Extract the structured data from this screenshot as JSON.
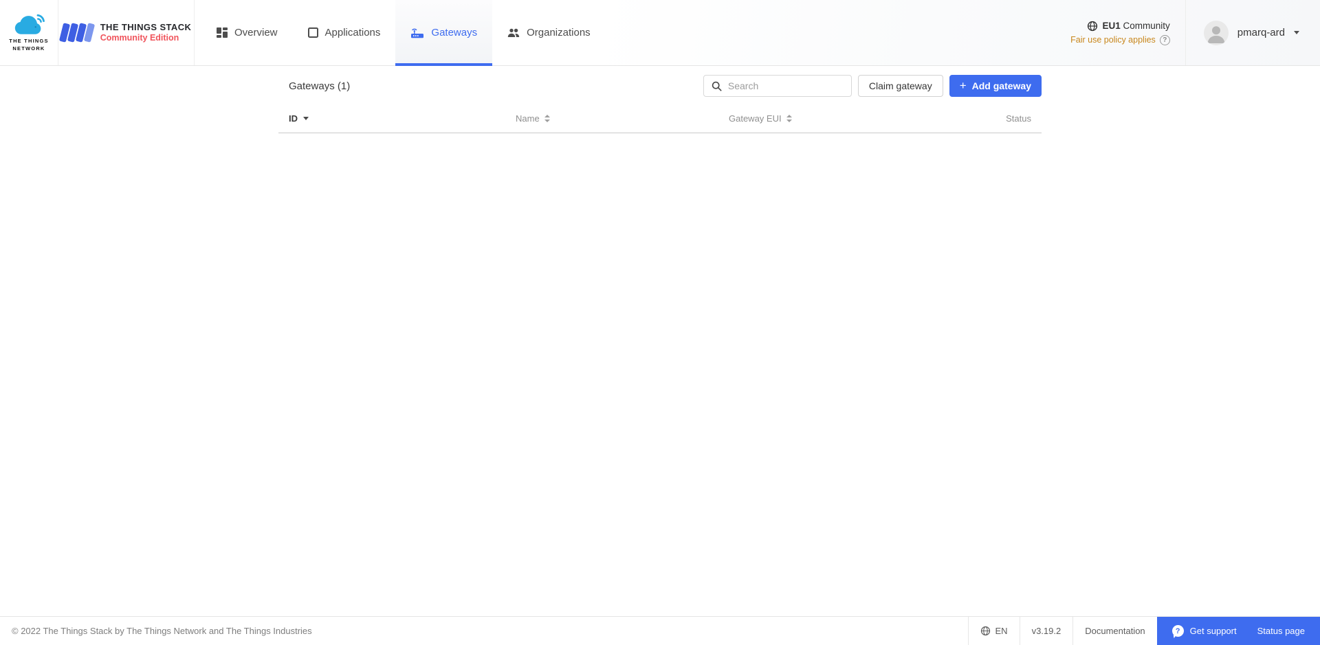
{
  "colors": {
    "primary": "#3e6cef",
    "ttn_blue": "#29abe2",
    "tts_red": "#f0545c",
    "warning": "#c8871c"
  },
  "header": {
    "ttn_logo": {
      "line1": "THE THINGS",
      "line2": "NETWORK"
    },
    "tts_logo": {
      "title": "THE THINGS STACK",
      "subtitle": "Community Edition"
    },
    "nav": [
      {
        "label": "Overview"
      },
      {
        "label": "Applications"
      },
      {
        "label": "Gateways"
      },
      {
        "label": "Organizations"
      }
    ],
    "cluster": {
      "name": "EU1",
      "type": "Community",
      "notice": "Fair use policy applies",
      "help_glyph": "?"
    },
    "user": {
      "name": "pmarq-ard"
    }
  },
  "main": {
    "title": "Gateways (1)",
    "search": {
      "placeholder": "Search"
    },
    "claim_button": "Claim gateway",
    "add_button": {
      "plus": "+",
      "label": "Add gateway"
    },
    "table": {
      "columns": [
        {
          "label": "ID"
        },
        {
          "label": "Name"
        },
        {
          "label": "Gateway EUI"
        },
        {
          "label": "Status"
        }
      ],
      "rows": []
    }
  },
  "footer": {
    "copyright": "© 2022 The Things Stack by The Things Network and The Things Industries",
    "language": "EN",
    "version": "v3.19.2",
    "documentation": "Documentation",
    "get_support": "Get support",
    "support_glyph": "?",
    "status_page": "Status page"
  }
}
